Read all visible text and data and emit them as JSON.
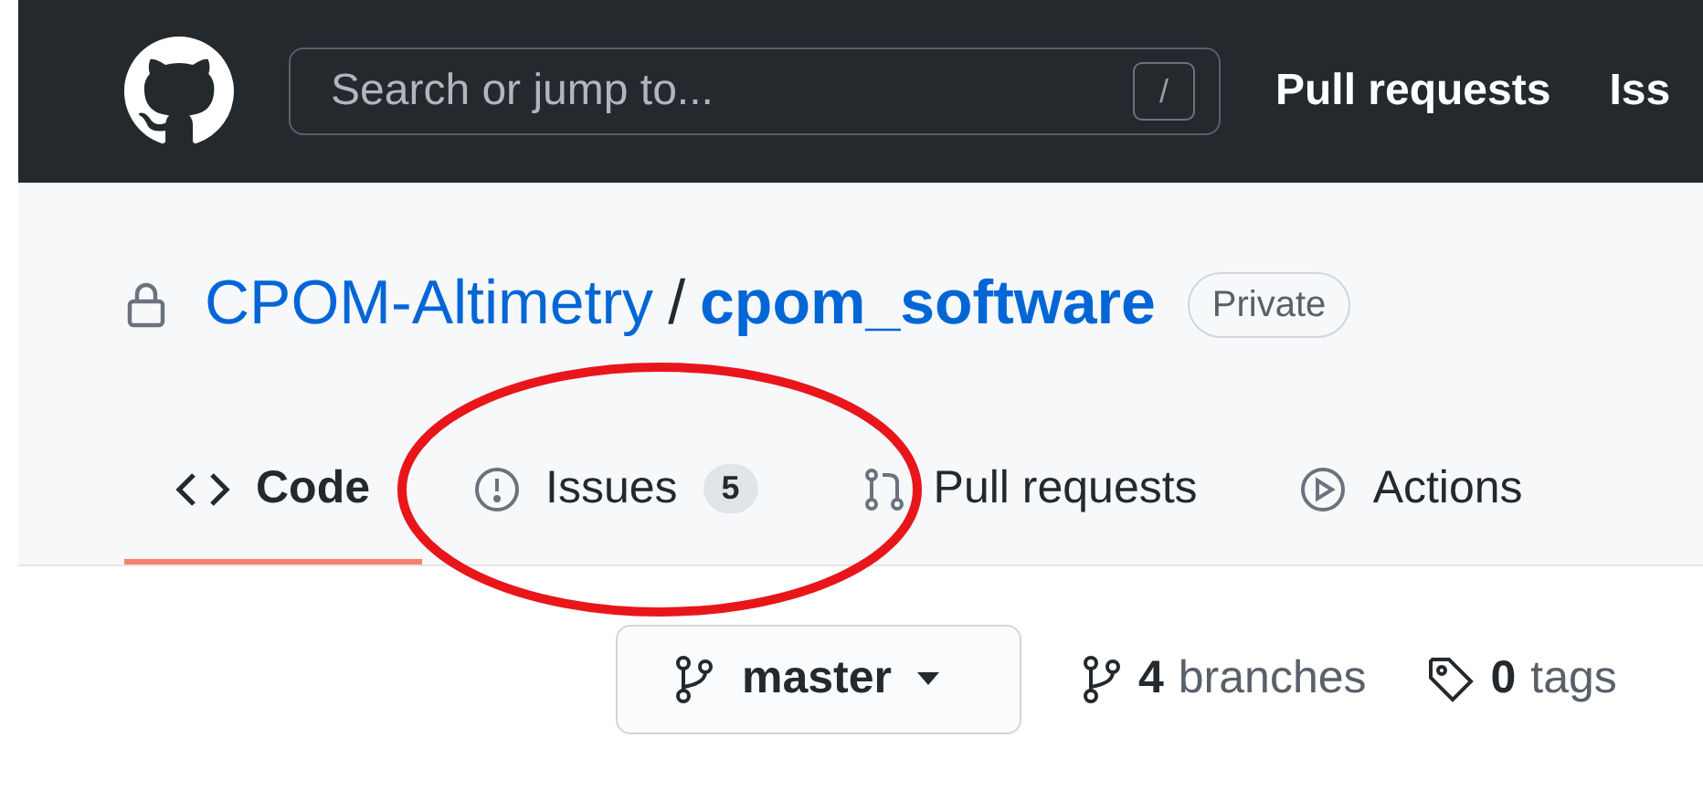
{
  "header": {
    "search": {
      "placeholder": "Search or jump to...",
      "shortcut": "/"
    },
    "nav": [
      "Pull requests",
      "Iss"
    ]
  },
  "repo": {
    "owner": "CPOM-Altimetry",
    "separator": "/",
    "name": "cpom_software",
    "visibility": "Private"
  },
  "tabs": [
    {
      "kind": "code",
      "label": "Code",
      "selected": true
    },
    {
      "kind": "issues",
      "label": "Issues",
      "counter": "5",
      "selected": false
    },
    {
      "kind": "pulls",
      "label": "Pull requests",
      "selected": false
    },
    {
      "kind": "actions",
      "label": "Actions",
      "selected": false
    }
  ],
  "branch": {
    "name": "master"
  },
  "stats": [
    {
      "kind": "branches",
      "count": "4",
      "label": "branches"
    },
    {
      "kind": "tags",
      "count": "0",
      "label": "tags"
    }
  ]
}
